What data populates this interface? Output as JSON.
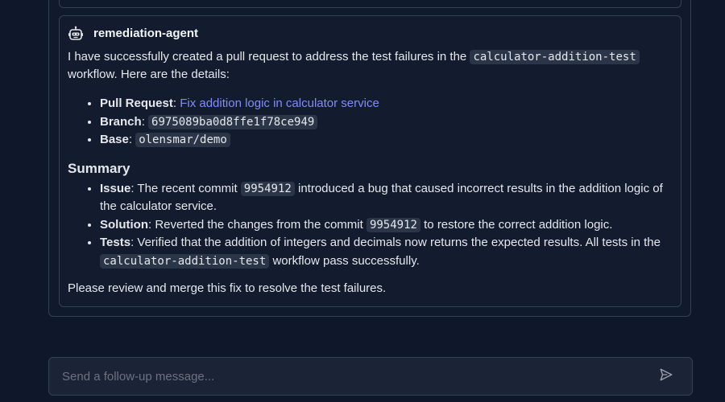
{
  "agent": {
    "name": "remediation-agent"
  },
  "message": {
    "intro_before": "I have successfully created a pull request to address the test failures in the ",
    "intro_code": "calculator-addition-test",
    "intro_after": " workflow. Here are the details:",
    "details": {
      "pull_request_label": "Pull Request",
      "pull_request_link": "Fix addition logic in calculator service",
      "branch_label": "Branch",
      "branch_value": "6975089ba0d8ffe1f78ce949",
      "base_label": "Base",
      "base_value": "olensmar/demo"
    },
    "summary_heading": "Summary",
    "summary": {
      "issue_label": "Issue",
      "issue_before": ": The recent commit ",
      "issue_code": "9954912",
      "issue_after": " introduced a bug that caused incorrect results in the addition logic of the calculator service.",
      "solution_label": "Solution",
      "solution_before": ": Reverted the changes from the commit ",
      "solution_code": "9954912",
      "solution_after": " to restore the correct addition logic.",
      "tests_label": "Tests",
      "tests_before": ": Verified that the addition of integers and decimals now returns the expected results. All tests in the ",
      "tests_code": "calculator-addition-test",
      "tests_after": " workflow pass successfully."
    },
    "closing": "Please review and merge this fix to resolve the test failures."
  },
  "composer": {
    "placeholder": "Send a follow-up message...",
    "send_icon": "send-icon"
  },
  "colors": {
    "background": "#0f172a",
    "link": "#818cf8",
    "code_bg": "#2a3547",
    "border": "#334155"
  }
}
